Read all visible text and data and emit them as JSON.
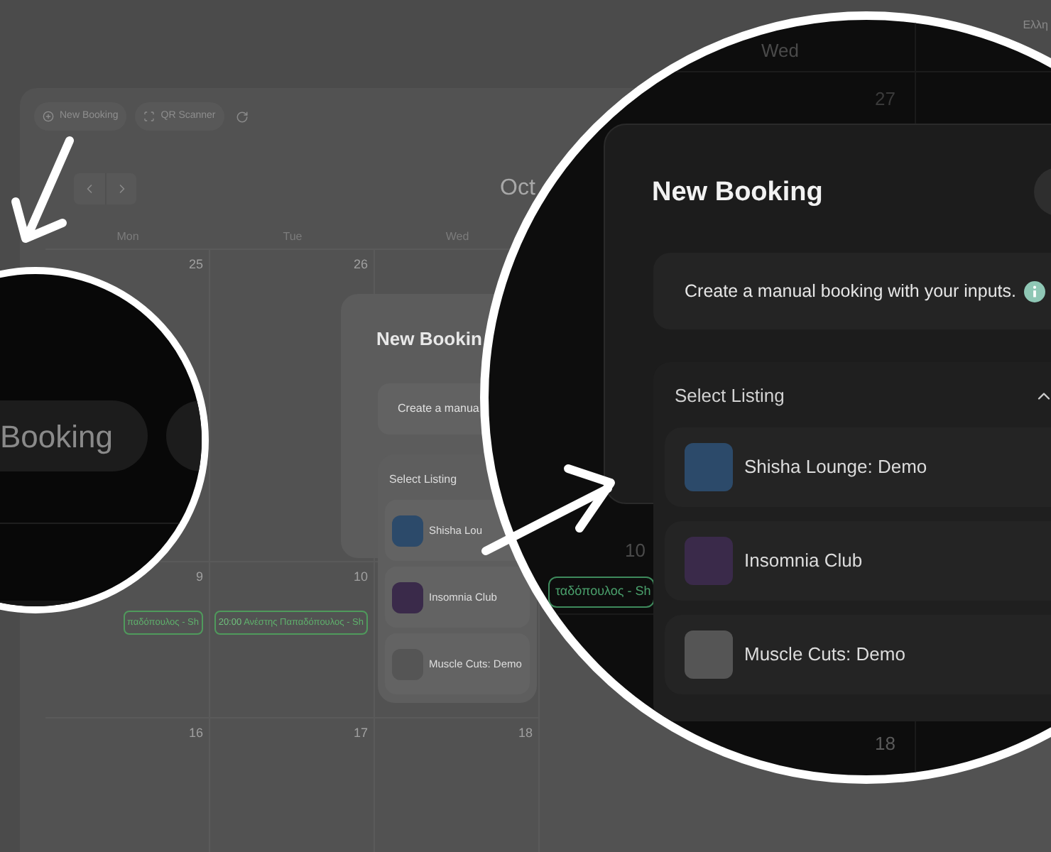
{
  "background": {
    "language": "Ελλη",
    "toolbar": [
      {
        "kind": "new",
        "label": "New Booking"
      },
      {
        "kind": "scan",
        "label": "QR Scanner"
      },
      {
        "kind": "refresh"
      }
    ],
    "month": "Oct",
    "weekdays": [
      "Mon",
      "Tue",
      "Wed"
    ],
    "weeks": [
      {
        "days": [
          {
            "date": "25"
          },
          {
            "date": "26"
          }
        ]
      },
      {
        "days": [
          {
            "date": "9",
            "events": [
              {
                "text": "παδόπουλος - Sh"
              }
            ]
          },
          {
            "date": "10",
            "events": [
              {
                "time": "20:00",
                "text": "Ανέστης Παπαδόπουλος - Sh"
              }
            ]
          }
        ]
      },
      {
        "days": [
          {
            "date": "16"
          },
          {
            "date": "17"
          },
          {
            "date": "18"
          }
        ]
      }
    ],
    "dialog": {
      "title": "New Bookin",
      "info": "Create a manua",
      "select_label": "Select Listing",
      "listings": [
        "Shisha Lou",
        "Insomnia Club",
        "Muscle Cuts: Demo"
      ]
    }
  },
  "zoom_small": {
    "button_label": "Booking"
  },
  "zoom_large": {
    "weekday": "Wed",
    "dates": [
      "27",
      "10",
      "18"
    ],
    "event": "ταδόπουλος - Sh",
    "dialog": {
      "title": "New Booking",
      "info": "Create a manual booking with your inputs.",
      "select_label": "Select Listing",
      "expanded": true,
      "listings": [
        "Shisha Lounge: Demo",
        "Insomnia Club",
        "Muscle Cuts: Demo"
      ]
    }
  }
}
